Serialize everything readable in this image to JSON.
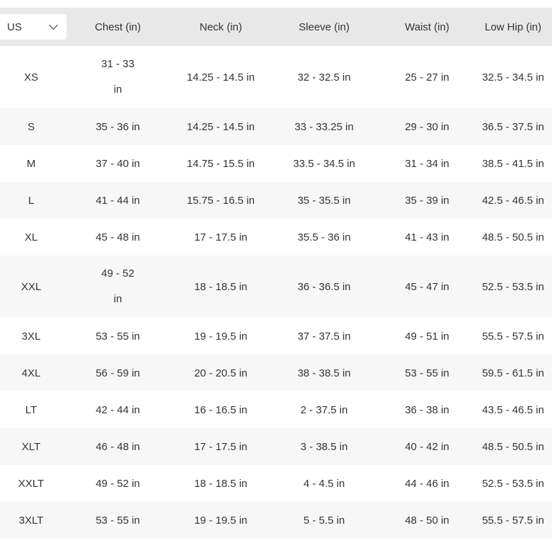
{
  "unit_selector": {
    "value": "US",
    "icon": "chevron-down-icon"
  },
  "headers": [
    "Chest (in)",
    "Neck (in)",
    "Sleeve (in)",
    "Waist (in)",
    "Low Hip (in)"
  ],
  "rows": [
    {
      "size": "XS",
      "chest": [
        "31 - 33",
        "in"
      ],
      "neck": "14.25 - 14.5 in",
      "sleeve": "32 - 32.5 in",
      "waist": "25 - 27 in",
      "low_hip": "32.5 - 34.5 in"
    },
    {
      "size": "S",
      "chest": [
        "35 - 36 in"
      ],
      "neck": "14.25 - 14.5 in",
      "sleeve": "33 - 33.25 in",
      "waist": "29 - 30 in",
      "low_hip": "36.5 - 37.5 in"
    },
    {
      "size": "M",
      "chest": [
        "37 - 40 in"
      ],
      "neck": "14.75 - 15.5 in",
      "sleeve": "33.5 - 34.5 in",
      "waist": "31 - 34 in",
      "low_hip": "38.5 - 41.5 in"
    },
    {
      "size": "L",
      "chest": [
        "41 - 44 in"
      ],
      "neck": "15.75 - 16.5 in",
      "sleeve": "35 - 35.5 in",
      "waist": "35 - 39 in",
      "low_hip": "42.5 - 46.5 in"
    },
    {
      "size": "XL",
      "chest": [
        "45 - 48 in"
      ],
      "neck": "17 - 17.5 in",
      "sleeve": "35.5 - 36 in",
      "waist": "41 - 43 in",
      "low_hip": "48.5 - 50.5 in"
    },
    {
      "size": "XXL",
      "chest": [
        "49 - 52",
        "in"
      ],
      "neck": "18 - 18.5 in",
      "sleeve": "36 - 36.5 in",
      "waist": "45 - 47 in",
      "low_hip": "52.5 - 53.5 in"
    },
    {
      "size": "3XL",
      "chest": [
        "53 - 55 in"
      ],
      "neck": "19 - 19.5 in",
      "sleeve": "37 - 37.5 in",
      "waist": "49 - 51 in",
      "low_hip": "55.5 - 57.5 in"
    },
    {
      "size": "4XL",
      "chest": [
        "56 - 59 in"
      ],
      "neck": "20 - 20.5 in",
      "sleeve": "38 - 38.5 in",
      "waist": "53 - 55 in",
      "low_hip": "59.5 - 61.5 in"
    },
    {
      "size": "LT",
      "chest": [
        "42 - 44 in"
      ],
      "neck": "16 - 16.5 in",
      "sleeve": "2 - 37.5 in",
      "waist": "36 - 38 in",
      "low_hip": "43.5 - 46.5 in"
    },
    {
      "size": "XLT",
      "chest": [
        "46 - 48 in"
      ],
      "neck": "17 - 17.5 in",
      "sleeve": "3 - 38.5 in",
      "waist": "40 - 42 in",
      "low_hip": "48.5 - 50.5 in"
    },
    {
      "size": "XXLT",
      "chest": [
        "49 - 52 in"
      ],
      "neck": "18 - 18.5 in",
      "sleeve": "4 - 4.5 in",
      "waist": "44 - 46 in",
      "low_hip": "52.5 - 53.5 in"
    },
    {
      "size": "3XLT",
      "chest": [
        "53 - 55 in"
      ],
      "neck": "19 - 19.5 in",
      "sleeve": "5 - 5.5 in",
      "waist": "48 - 50 in",
      "low_hip": "55.5 - 57.5 in"
    }
  ]
}
